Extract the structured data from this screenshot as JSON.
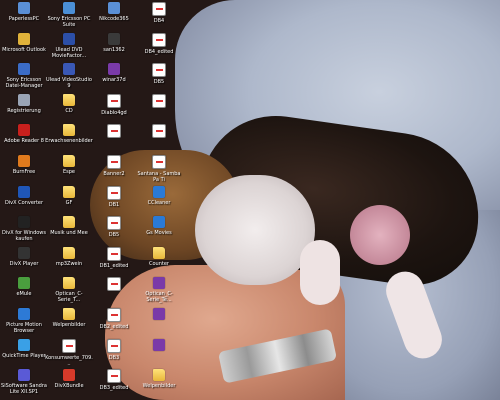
{
  "desktop": {
    "columns": [
      [
        {
          "label": "PaperlessPC",
          "icon": "application-icon",
          "color": "#5a8fd6"
        },
        {
          "label": "Microsoft Outlook",
          "icon": "outlook-icon",
          "color": "#e0b23a"
        },
        {
          "label": "Sony Ericsson Datei-Manager",
          "icon": "sony-ericsson-icon",
          "color": "#3b6cc7"
        },
        {
          "label": "Registrierung",
          "icon": "registration-icon",
          "color": "#9aa4b5"
        },
        {
          "label": "Adobe Reader 8",
          "icon": "adobe-reader-icon",
          "color": "#c8201d"
        },
        {
          "label": "BurnFree",
          "icon": "burn-icon",
          "color": "#e07a1d"
        },
        {
          "label": "DivX Converter",
          "icon": "divx-icon",
          "color": "#1f56b8"
        },
        {
          "label": "DivX for Windows kaufen",
          "icon": "divx-icon",
          "color": "#222222"
        },
        {
          "label": "DivX Player",
          "icon": "divx-player-icon",
          "color": "#333333"
        },
        {
          "label": "eMule",
          "icon": "emule-icon",
          "color": "#4a9e3e"
        },
        {
          "label": "Picture Motion Browser",
          "icon": "picture-browser-icon",
          "color": "#2d7ad6"
        },
        {
          "label": "QuickTime Player",
          "icon": "quicktime-icon",
          "color": "#3aa0e6"
        },
        {
          "label": "SiSoftware Sandra Lite XII.SP1",
          "icon": "sandra-icon",
          "color": "#5a5ad6"
        }
      ],
      [
        {
          "label": "Sony Ericsson PC Suite",
          "icon": "pc-suite-icon",
          "color": "#4b8fd6"
        },
        {
          "label": "Ulead DVD MovieFactor...",
          "icon": "ulead-icon",
          "color": "#2c4fa8"
        },
        {
          "label": "Ulead VideoStudio 9",
          "icon": "videostudio-icon",
          "color": "#3a58b6"
        },
        {
          "label": "CD",
          "icon": "folder-icon",
          "color": "#f0c040"
        },
        {
          "label": "Erwachsenenbilder",
          "icon": "folder-icon",
          "color": "#f0c040"
        },
        {
          "label": "Espe",
          "icon": "folder-icon",
          "color": "#f0c040"
        },
        {
          "label": "GF",
          "icon": "folder-icon",
          "color": "#f0c040"
        },
        {
          "label": "Musik und Mee",
          "icon": "folder-icon",
          "color": "#f0c040"
        },
        {
          "label": "mp3Zwein",
          "icon": "folder-icon",
          "color": "#f0c040"
        },
        {
          "label": "Optican_C-Serie_T...",
          "icon": "folder-icon",
          "color": "#f0c040"
        },
        {
          "label": "Welpenbilder",
          "icon": "folder-icon",
          "color": "#f0c040"
        },
        {
          "label": "Konsumwerte_709...",
          "icon": "document-icon",
          "color": "#ffffff"
        },
        {
          "label": "DivXBundle",
          "icon": "divx-bundle-icon",
          "color": "#d63a2a"
        }
      ],
      [
        {
          "label": "Nikcode365",
          "icon": "application-icon",
          "color": "#5a8fd6"
        },
        {
          "label": "san1362",
          "icon": "application-icon",
          "color": "#3a3a3a"
        },
        {
          "label": "winar37d",
          "icon": "winrar-icon",
          "color": "#7a3aa8"
        },
        {
          "label": "Diablo4gd",
          "icon": "document-icon",
          "color": "#ffffff"
        },
        {
          "label": "",
          "icon": "document-icon",
          "color": "#ffffff"
        },
        {
          "label": "Banner2",
          "icon": "document-icon",
          "color": "#ffffff"
        },
        {
          "label": "DB1",
          "icon": "document-icon",
          "color": "#ffffff"
        },
        {
          "label": "DB5",
          "icon": "document-icon",
          "color": "#ffffff"
        },
        {
          "label": "DB1_edited",
          "icon": "document-icon",
          "color": "#ffffff"
        },
        {
          "label": "",
          "icon": "document-icon",
          "color": "#ffffff"
        },
        {
          "label": "DB2_edited",
          "icon": "document-icon",
          "color": "#ffffff"
        },
        {
          "label": "DB3",
          "icon": "document-icon",
          "color": "#ffffff"
        },
        {
          "label": "DB3_edited",
          "icon": "document-icon",
          "color": "#ffffff"
        }
      ],
      [
        {
          "label": "DB4",
          "icon": "document-icon",
          "color": "#ffffff"
        },
        {
          "label": "DB4_edited",
          "icon": "document-icon",
          "color": "#ffffff"
        },
        {
          "label": "DB5",
          "icon": "document-icon",
          "color": "#ffffff"
        },
        {
          "label": "",
          "icon": "document-icon",
          "color": "#ffffff"
        },
        {
          "label": "",
          "icon": "document-icon",
          "color": "#ffffff"
        },
        {
          "label": "Santana - Samba Pa Ti",
          "icon": "media-file-icon",
          "color": "#ffffff"
        },
        {
          "label": "CCleaner",
          "icon": "ccleaner-icon",
          "color": "#2a7ad6"
        },
        {
          "label": "Gs Movies",
          "icon": "movies-icon",
          "color": "#2a7ad6"
        },
        {
          "label": "Counter",
          "icon": "folder-icon",
          "color": "#f0c040"
        },
        {
          "label": "Optican_C-Serie_Te...",
          "icon": "winrar-icon",
          "color": "#7a3aa8"
        },
        {
          "label": "",
          "icon": "winrar-icon",
          "color": "#7a3aa8"
        },
        {
          "label": "",
          "icon": "winrar-icon",
          "color": "#7a3aa8"
        },
        {
          "label": "Welpenbilder",
          "icon": "folder-icon",
          "color": "#f0c040"
        }
      ]
    ]
  }
}
